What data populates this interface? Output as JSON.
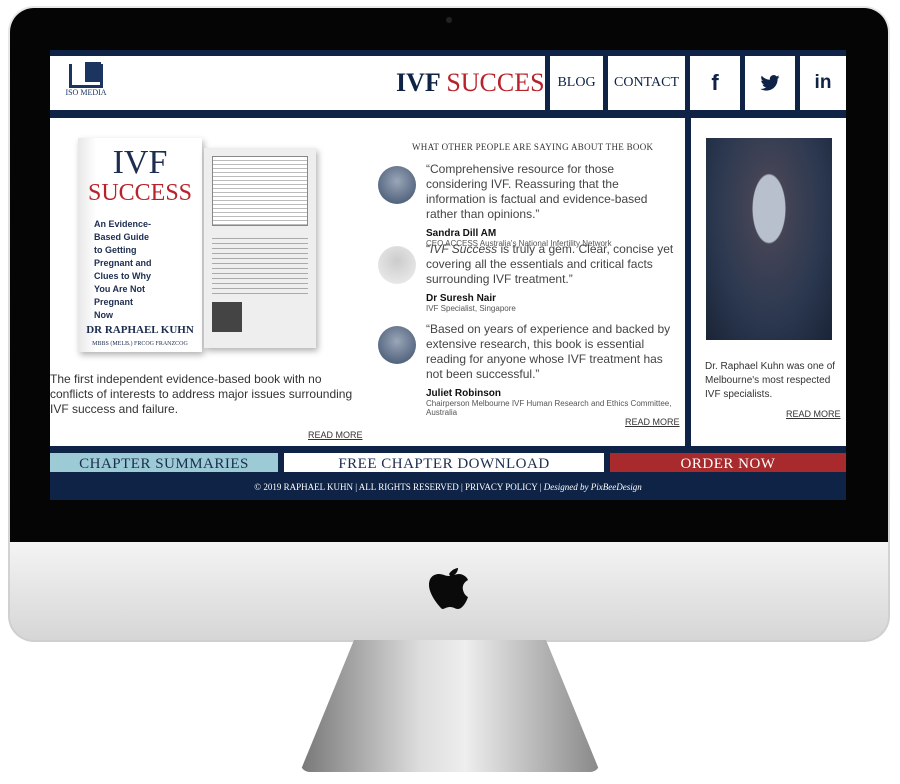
{
  "header": {
    "logo_text": "ISO MEDIA",
    "title_part1": "IVF",
    "title_part2": "SUCCESS",
    "nav": [
      {
        "label": "BLOG"
      },
      {
        "label": "CONTACT"
      }
    ],
    "social": [
      {
        "icon": "facebook-icon",
        "glyph": "f"
      },
      {
        "icon": "twitter-icon",
        "glyph": "🐦"
      },
      {
        "icon": "linkedin-icon",
        "glyph": "in"
      }
    ]
  },
  "book": {
    "title1": "IVF",
    "title2": "SUCCESS",
    "subtitle": "An Evidence-Based Guide to Getting Pregnant and Clues to Why You Are Not Pregnant Now",
    "author": "DR RAPHAEL KUHN",
    "credentials": "MBBS (MELB.) FRCOG FRANZCOG"
  },
  "intro": {
    "text": "The first independent evidence-based book with no conflicts of interests to address major issues surrounding IVF success and failure.",
    "read_more": "READ MORE"
  },
  "testimonials": {
    "heading": "WHAT OTHER PEOPLE ARE SAYING ABOUT THE BOOK",
    "items": [
      {
        "quote": "“Comprehensive resource for those considering IVF. Reassuring that the information is factual and evidence-based rather than opinions.”",
        "name": "Sandra Dill AM",
        "role": "CEO ACCESS Australia's National Infertility Network"
      },
      {
        "quote_em": "IVF Success",
        "quote_pre": "“",
        "quote": " is truly a gem. Clear, concise yet covering all the essentials and critical facts surrounding IVF treatment.”",
        "name": "Dr Suresh Nair",
        "role": "IVF Specialist, Singapore"
      },
      {
        "quote": "“Based on years of experience and backed by extensive research, this book is essential reading for anyone whose IVF treatment has not been successful.”",
        "name": "Juliet Robinson",
        "role": "Chairperson Melbourne IVF Human Research and Ethics Committee, Australia"
      }
    ],
    "read_more": "READ MORE"
  },
  "author": {
    "text": "Dr. Raphael Kuhn was one of Melbourne's most respected IVF specialists.",
    "read_more": "READ MORE"
  },
  "buttons": [
    {
      "label": "CHAPTER SUMMARIES",
      "color": "#9ccbd6"
    },
    {
      "label": "FREE CHAPTER DOWNLOAD",
      "color": "#ffffff"
    },
    {
      "label": "ORDER NOW",
      "color": "#a82a2c"
    }
  ],
  "footer": {
    "text": "© 2019 RAPHAEL KUHN | ALL RIGHTS RESERVED | PRIVACY POLICY |",
    "designer": "Designed by PixBeeDesign"
  },
  "colors": {
    "navy": "#0e2346",
    "red": "#b8232b"
  }
}
